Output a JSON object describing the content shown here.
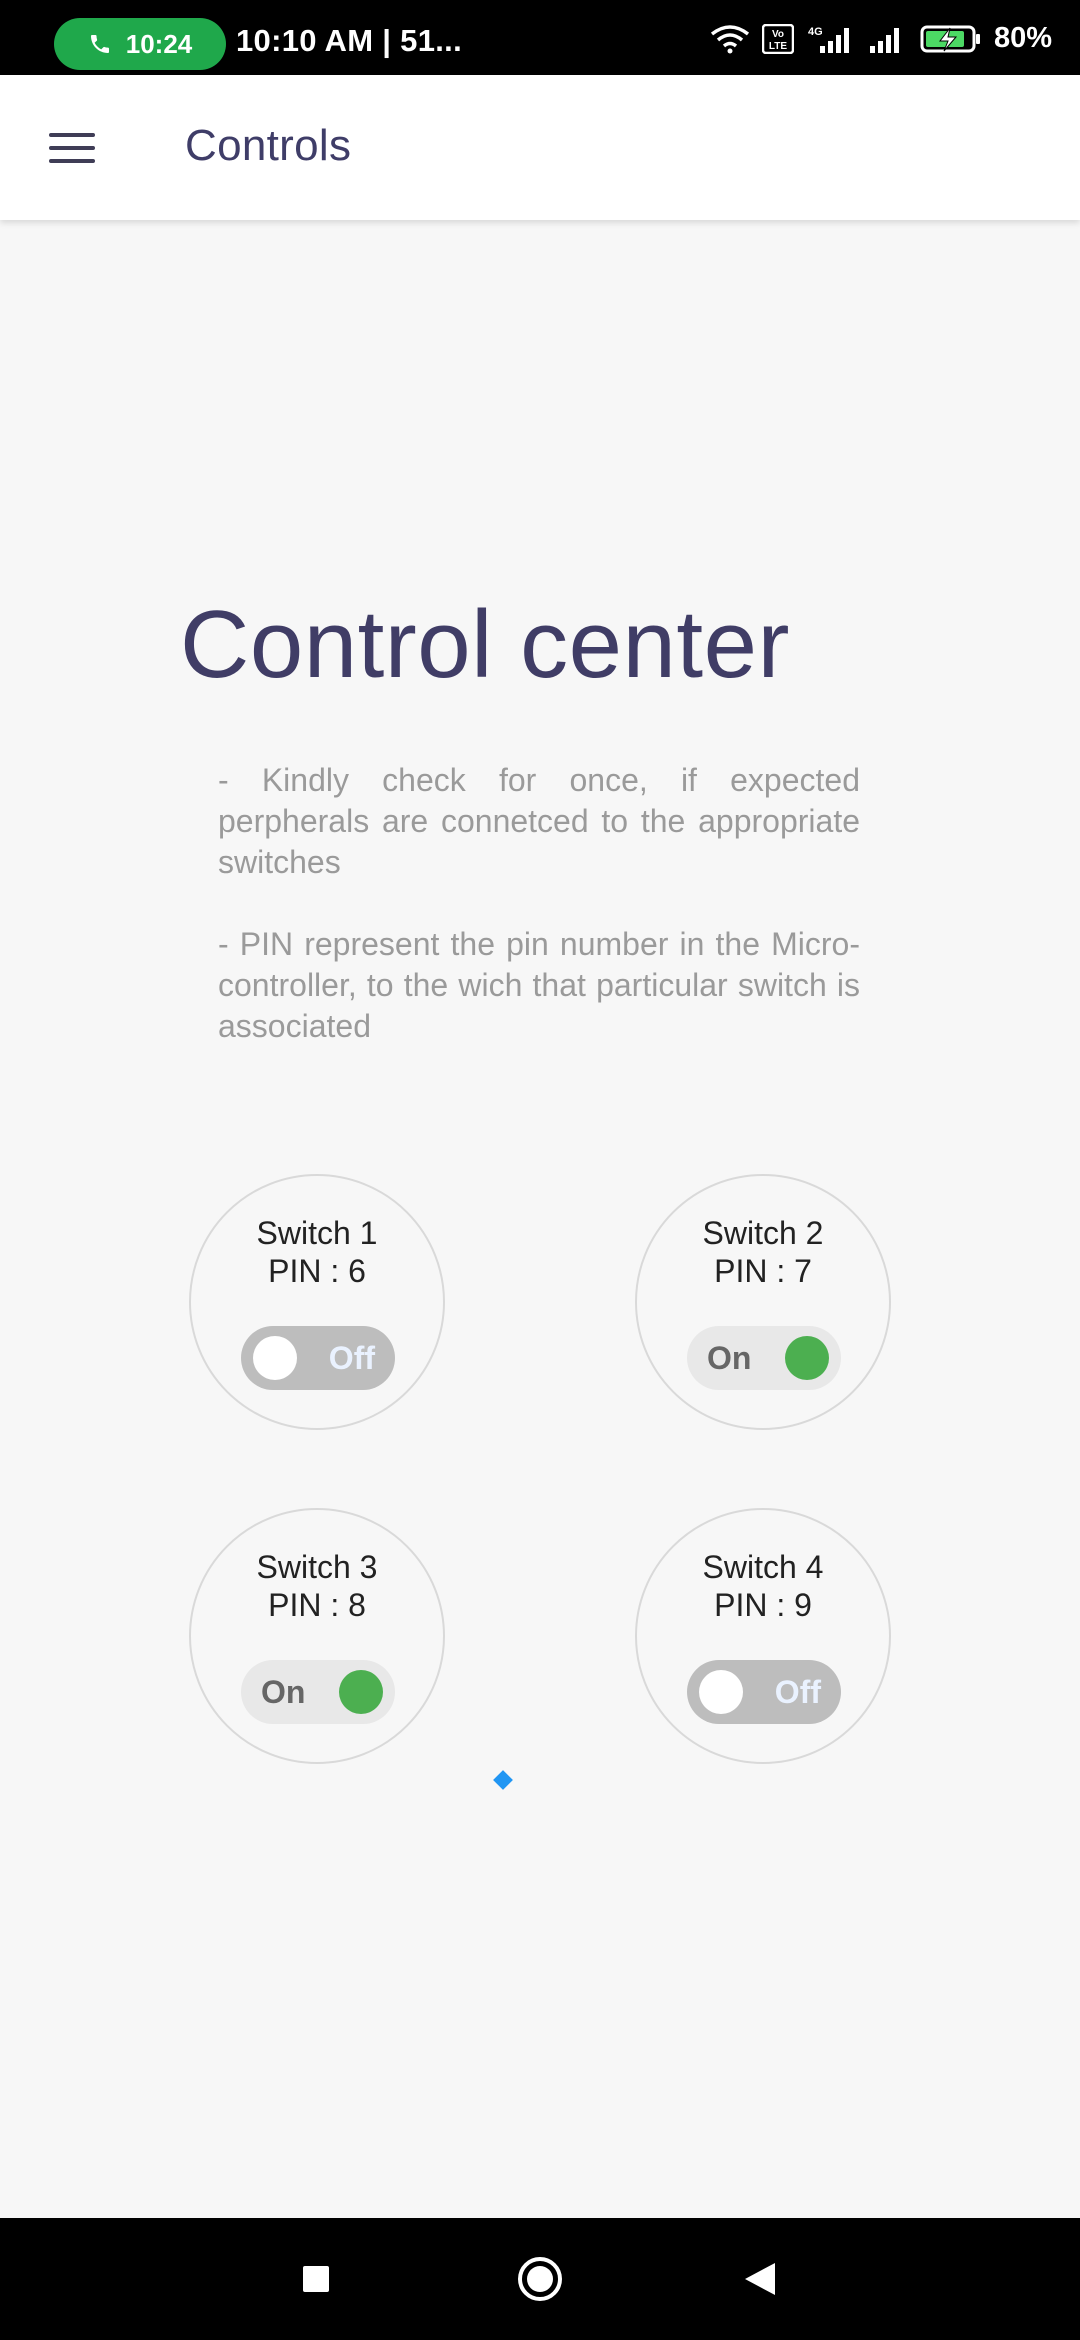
{
  "status_bar": {
    "call_time": "10:24",
    "time_text": "10:10 AM | 51...",
    "network": "4G",
    "volte": "Vo LTE",
    "battery": "80%"
  },
  "app_bar": {
    "title": "Controls",
    "menu_icon": "hamburger-menu-icon"
  },
  "main": {
    "headline": "Control center",
    "info_1": "- Kindly check for once, if expected perpherals are connetced to the appropriate switches",
    "info_2": "- PIN represent the pin number in the Micro-controller, to the wich that particular switch is associated"
  },
  "switches": [
    {
      "name": "Switch 1",
      "pin": "PIN : 6",
      "state": "Off"
    },
    {
      "name": "Switch 2",
      "pin": "PIN : 7",
      "state": "On"
    },
    {
      "name": "Switch 3",
      "pin": "PIN : 8",
      "state": "On"
    },
    {
      "name": "Switch 4",
      "pin": "PIN : 9",
      "state": "Off"
    }
  ],
  "colors": {
    "accent": "#403d66",
    "on": "#4caf50",
    "off_track": "#bdbdbd",
    "call_pill": "#1fa84b"
  },
  "nav_bar": {
    "recent_icon": "recent-apps-icon",
    "home_icon": "home-icon",
    "back_icon": "back-icon"
  }
}
